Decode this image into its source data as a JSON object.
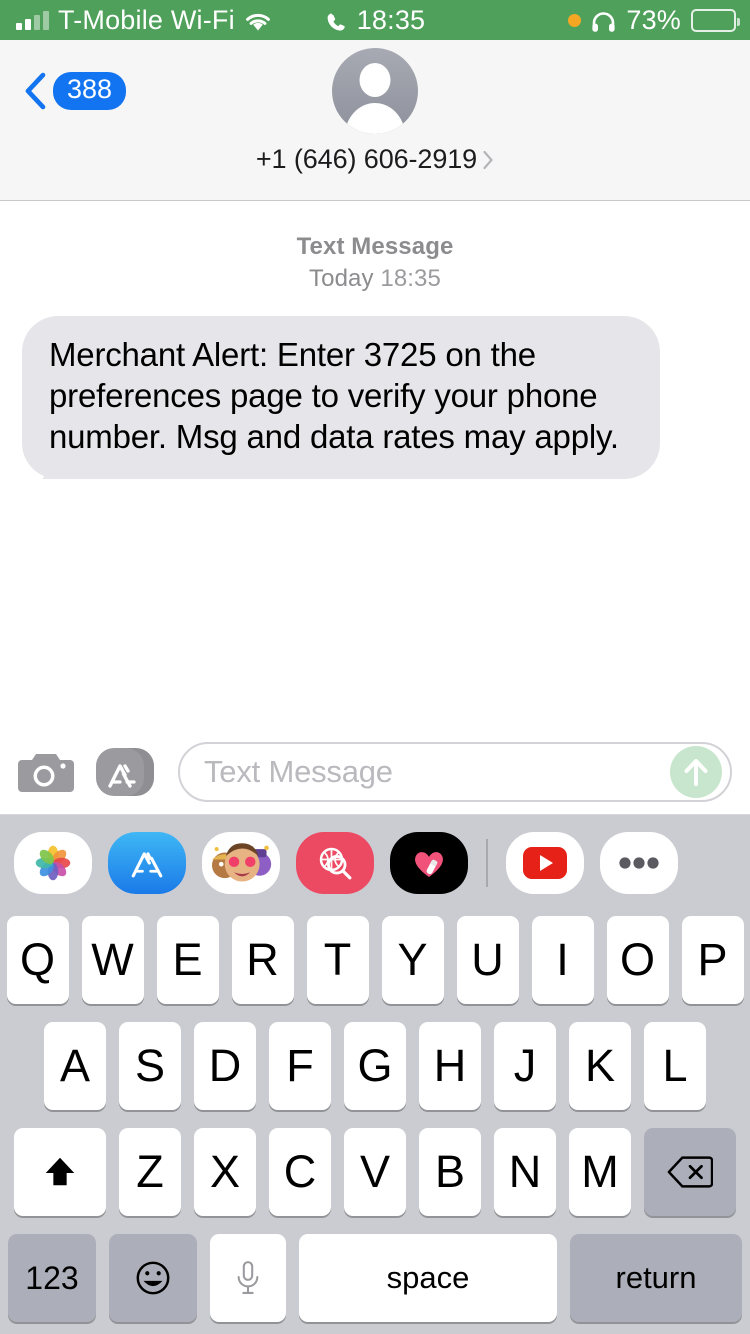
{
  "status_bar": {
    "carrier": "T-Mobile Wi-Fi",
    "time": "18:35",
    "battery_percent": "73%",
    "battery_level": 73,
    "background_color": "#4fa05a",
    "icons": [
      "signal-bars-icon",
      "wifi-icon",
      "phone-call-icon",
      "recording-dot-icon",
      "headphones-icon",
      "battery-icon"
    ]
  },
  "nav_bar": {
    "back_badge": "388",
    "contact_name": "+1 (646) 606-2919",
    "badge_color": "#1274f0",
    "chevron_color": "#1274f0"
  },
  "conversation": {
    "meta_kind": "Text Message",
    "meta_day": "Today",
    "meta_time": "18:35",
    "messages": [
      {
        "sender": "them",
        "text": "Merchant Alert: Enter 3725 on the preferences page to verify your phone number. Msg and data rates may apply.",
        "bubble_color": "#e5e5ea",
        "text_color": "#000000"
      }
    ]
  },
  "input_bar": {
    "camera_label": "Camera",
    "apps_label": "App Store",
    "placeholder": "Text Message",
    "value": "",
    "send_label": "Send",
    "send_color": "#c8e6cd"
  },
  "app_drawer": {
    "items": [
      {
        "name": "photos-app-icon",
        "label": "Photos"
      },
      {
        "name": "app-store-app-icon",
        "label": "App Store"
      },
      {
        "name": "memoji-app-icon",
        "label": "Memoji Stickers"
      },
      {
        "name": "images-search-app-icon",
        "label": "#images"
      },
      {
        "name": "digital-touch-app-icon",
        "label": "Digital Touch"
      },
      {
        "name": "youtube-app-icon",
        "label": "YouTube"
      },
      {
        "name": "more-apps-icon",
        "label": "More"
      }
    ]
  },
  "keyboard": {
    "row1": [
      "Q",
      "W",
      "E",
      "R",
      "T",
      "Y",
      "U",
      "I",
      "O",
      "P"
    ],
    "row2": [
      "A",
      "S",
      "D",
      "F",
      "G",
      "H",
      "J",
      "K",
      "L"
    ],
    "row3": [
      "Z",
      "X",
      "C",
      "V",
      "B",
      "N",
      "M"
    ],
    "shift_label": "shift",
    "delete_label": "delete",
    "numbers_label": "123",
    "emoji_label": "emoji",
    "dictation_label": "dictation",
    "space_label": "space",
    "return_label": "return"
  }
}
